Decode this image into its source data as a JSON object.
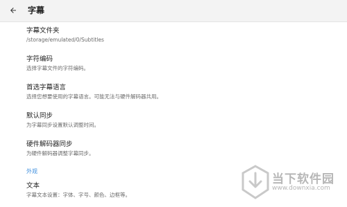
{
  "appbar": {
    "title": "字幕",
    "back_icon": "arrow-back-icon"
  },
  "prefs": [
    {
      "title": "字幕文件夹",
      "summary": "/storage/emulated/0/Subtitles"
    },
    {
      "title": "字符编码",
      "summary": "选择字幕文件的字符编码。"
    },
    {
      "title": "首选字幕语言",
      "summary": "选择您想要使用的字幕语言。可能无法与硬件解码器共用。"
    },
    {
      "title": "默认同步",
      "summary": "为字幕同步设置默认调整时间。"
    },
    {
      "title": "硬件解码器同步",
      "summary": "为硬件解码器调整字幕同步。"
    }
  ],
  "category": {
    "label": "外观"
  },
  "appearance_pref": {
    "title": "文本",
    "summary": "字幕文本设置：字体、字号、颜色、边框等。"
  },
  "watermark": {
    "text": "当下软件园",
    "url": "www.downxia.com"
  },
  "colors": {
    "accent": "#3b8ddd",
    "appbar_bg": "#f3f3f3"
  }
}
